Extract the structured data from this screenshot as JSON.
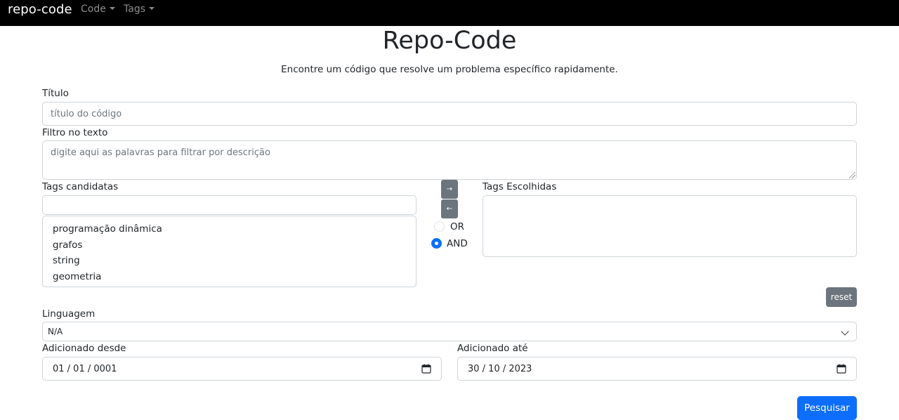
{
  "navbar": {
    "brand": "repo-code",
    "menus": [
      {
        "label": "Code"
      },
      {
        "label": "Tags"
      }
    ]
  },
  "header": {
    "title": "Repo-Code",
    "subtitle": "Encontre um código que resolve um problema específico rapidamente."
  },
  "form": {
    "titulo": {
      "label": "Título",
      "placeholder": "título do código",
      "value": ""
    },
    "filtro": {
      "label": "Filtro no texto",
      "placeholder": "digite aqui as palavras para filtrar por descrição",
      "value": ""
    },
    "tags_candidatas": {
      "label": "Tags candidatas",
      "filter_value": "",
      "items": [
        "programação dinâmica",
        "grafos",
        "string",
        "geometria"
      ]
    },
    "transfer": {
      "add_label": "→",
      "remove_label": "←"
    },
    "logic": {
      "options": [
        {
          "label": "OR",
          "checked": false
        },
        {
          "label": "AND",
          "checked": true
        }
      ]
    },
    "tags_escolhidas": {
      "label": "Tags Escolhidas",
      "items": []
    },
    "reset_label": "reset",
    "linguagem": {
      "label": "Linguagem",
      "selected": "N/A"
    },
    "desde": {
      "label": "Adicionado desde",
      "value": "01 / 01 / 0001"
    },
    "ate": {
      "label": "Adicionado até",
      "value": "30 / 10 / 2023"
    },
    "submit_label": "Pesquisar"
  },
  "colors": {
    "navbar_bg": "#000000",
    "primary": "#0d6efd",
    "secondary": "#6c757d"
  }
}
